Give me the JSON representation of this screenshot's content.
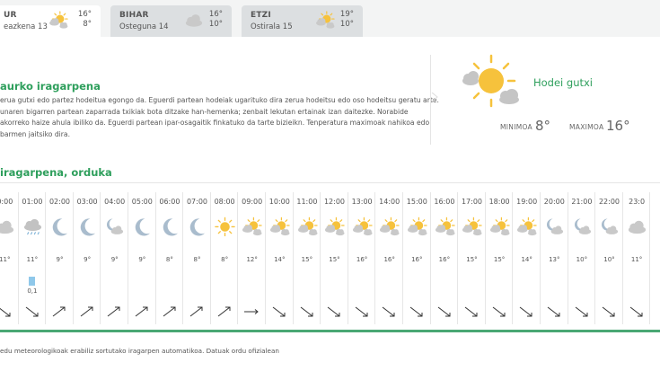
{
  "tabs": [
    {
      "day": "UR",
      "date": "eazkena 13",
      "max": "16°",
      "min": "8°",
      "icon": "sun-cloud-icon",
      "active": true
    },
    {
      "day": "BIHAR",
      "date": "Osteguna 14",
      "max": "16°",
      "min": "10°",
      "icon": "cloud-icon",
      "active": false
    },
    {
      "day": "ETZI",
      "date": "Ostirala 15",
      "max": "19°",
      "min": "10°",
      "icon": "sun-cloud-icon",
      "active": false
    }
  ],
  "summary": {
    "title": "aurko iragarpena",
    "lines": [
      "erua gutxi edo partez hodeitua egongo da. Eguerdi partean hodeiak ugarituko dira zerua hodeitsu edo oso hodeitsu geratu arte.",
      "unaren bigarren partean zaparrada txikiak bota ditzake han-hemenka; zenbait lekutan ertainak izan daitezke. Norabide",
      "akorreko haize ahula ibiliko da. Eguerdi partean ipar-osagaitik finkatuko da tarte bizieikn. Tenperatura maximoak nahikoa edo",
      "barmen jaitsiko dira."
    ]
  },
  "current": {
    "condition": "Hodei gutxi",
    "min_label": "MINIMOA",
    "min_value": "8°",
    "max_label": "MAXIMOA",
    "max_value": "16°",
    "icon": "sun-cloud-icon"
  },
  "hourly_title": "iragarpena, orduka",
  "hours": [
    {
      "time": "0:00",
      "icon": "cloud-icon",
      "temp": "11°",
      "rain": "",
      "wind": "se"
    },
    {
      "time": "01:00",
      "icon": "rain-cloud-icon",
      "temp": "11°",
      "rain": "0,1",
      "wind": "se"
    },
    {
      "time": "02:00",
      "icon": "moon-icon",
      "temp": "9°",
      "rain": "",
      "wind": "ne"
    },
    {
      "time": "03:00",
      "icon": "moon-icon",
      "temp": "9°",
      "rain": "",
      "wind": "ne"
    },
    {
      "time": "04:00",
      "icon": "moon-cloud-icon",
      "temp": "9°",
      "rain": "",
      "wind": "ne"
    },
    {
      "time": "05:00",
      "icon": "moon-icon",
      "temp": "9°",
      "rain": "",
      "wind": "ne"
    },
    {
      "time": "06:00",
      "icon": "moon-icon",
      "temp": "8°",
      "rain": "",
      "wind": "ne"
    },
    {
      "time": "07:00",
      "icon": "moon-icon",
      "temp": "8°",
      "rain": "",
      "wind": "ne"
    },
    {
      "time": "08:00",
      "icon": "sun-icon",
      "temp": "8°",
      "rain": "",
      "wind": "ne"
    },
    {
      "time": "09:00",
      "icon": "sun-cloud-icon",
      "temp": "12°",
      "rain": "",
      "wind": "e"
    },
    {
      "time": "10:00",
      "icon": "sun-cloud-icon",
      "temp": "14°",
      "rain": "",
      "wind": "se"
    },
    {
      "time": "11:00",
      "icon": "sun-cloud-icon",
      "temp": "15°",
      "rain": "",
      "wind": "se"
    },
    {
      "time": "12:00",
      "icon": "sun-cloud-icon",
      "temp": "15°",
      "rain": "",
      "wind": "se"
    },
    {
      "time": "13:00",
      "icon": "sun-cloud-icon",
      "temp": "16°",
      "rain": "",
      "wind": "se"
    },
    {
      "time": "14:00",
      "icon": "sun-cloud-icon",
      "temp": "16°",
      "rain": "",
      "wind": "se"
    },
    {
      "time": "15:00",
      "icon": "sun-cloud-icon",
      "temp": "16°",
      "rain": "",
      "wind": "se"
    },
    {
      "time": "16:00",
      "icon": "sun-cloud-icon",
      "temp": "16°",
      "rain": "",
      "wind": "se"
    },
    {
      "time": "17:00",
      "icon": "sun-cloud-icon",
      "temp": "15°",
      "rain": "",
      "wind": "se"
    },
    {
      "time": "18:00",
      "icon": "sun-cloud-icon",
      "temp": "15°",
      "rain": "",
      "wind": "se"
    },
    {
      "time": "19:00",
      "icon": "sun-cloud-icon",
      "temp": "14°",
      "rain": "",
      "wind": "se"
    },
    {
      "time": "20:00",
      "icon": "moon-cloud-icon",
      "temp": "13°",
      "rain": "",
      "wind": "se"
    },
    {
      "time": "21:00",
      "icon": "moon-cloud-icon",
      "temp": "10°",
      "rain": "",
      "wind": "se"
    },
    {
      "time": "22:00",
      "icon": "moon-cloud-icon",
      "temp": "10°",
      "rain": "",
      "wind": "se"
    },
    {
      "time": "23:0",
      "icon": "cloud-icon",
      "temp": "11°",
      "rain": "",
      "wind": "se"
    }
  ],
  "footer": "edu meteorologikoak erabiliz sortutako iragarpen automatikoa. Datuak ordu ofizialean",
  "colors": {
    "accent": "#2e9f5c",
    "sun": "#f6c23c",
    "cloud": "#c9c9c9",
    "moon": "#a9bccd",
    "rain": "#8fc8ea"
  }
}
